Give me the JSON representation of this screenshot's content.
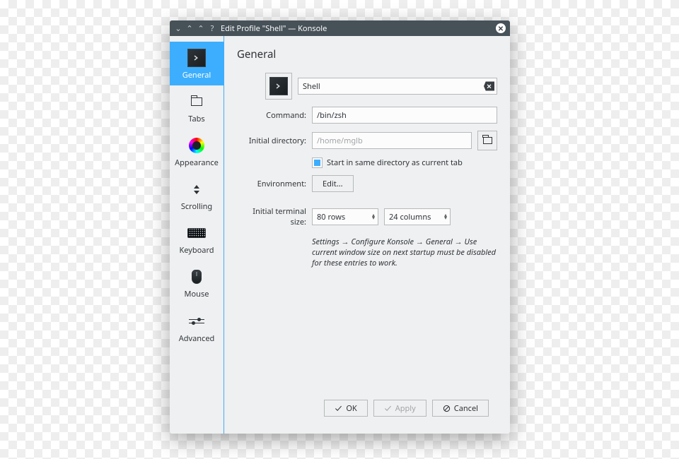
{
  "window": {
    "title": "Edit Profile \"Shell\" — Konsole"
  },
  "sidebar": {
    "items": [
      {
        "label": "General"
      },
      {
        "label": "Tabs"
      },
      {
        "label": "Appearance"
      },
      {
        "label": "Scrolling"
      },
      {
        "label": "Keyboard"
      },
      {
        "label": "Mouse"
      },
      {
        "label": "Advanced"
      }
    ],
    "active": 0
  },
  "page": {
    "heading": "General",
    "name_value": "Shell",
    "command_label": "Command:",
    "command_value": "/bin/zsh",
    "initdir_label": "Initial directory:",
    "initdir_placeholder": "/home/mglb",
    "samedir_label": "Start in same directory as current tab",
    "samedir_checked": true,
    "env_label": "Environment:",
    "env_button": "Edit...",
    "termsize_label": "Initial terminal size:",
    "rows_value": "80",
    "rows_suffix": "rows",
    "cols_value": "24",
    "cols_suffix": "columns",
    "hint_path": "Settings → Configure Konsole → General → Use current window size on next startup",
    "hint_rest": " must be disabled for these entries to work."
  },
  "buttons": {
    "ok": "OK",
    "apply": "Apply",
    "cancel": "Cancel"
  }
}
